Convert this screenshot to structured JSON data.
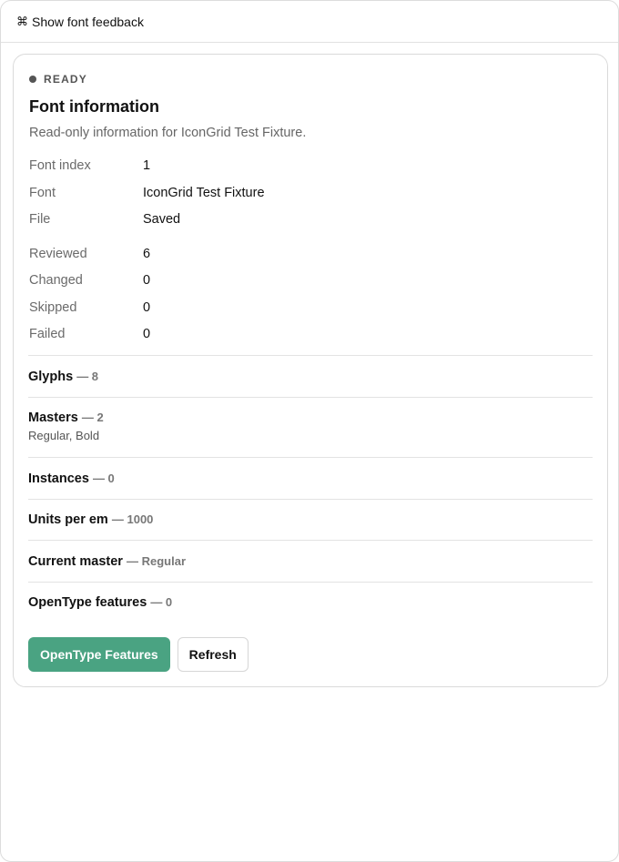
{
  "topbar": {
    "shortcut_icon": "⌘",
    "label": "Show font feedback"
  },
  "status": {
    "label": "READY",
    "dot_color": "#555555"
  },
  "header": {
    "title": "Font information",
    "subtitle": "Read-only information for IconGrid Test Fixture."
  },
  "info": [
    {
      "key": "Font index",
      "value": "1"
    },
    {
      "key": "Font",
      "value": "IconGrid Test Fixture"
    },
    {
      "key": "File",
      "value": "Saved"
    }
  ],
  "stats": [
    {
      "key": "Reviewed",
      "value": "6"
    },
    {
      "key": "Changed",
      "value": "0"
    },
    {
      "key": "Skipped",
      "value": "0"
    },
    {
      "key": "Failed",
      "value": "0"
    }
  ],
  "sections": [
    {
      "label": "Glyphs",
      "value": "— 8",
      "sub": ""
    },
    {
      "label": "Masters",
      "value": "— 2",
      "sub": "Regular, Bold"
    },
    {
      "label": "Instances",
      "value": "— 0",
      "sub": ""
    },
    {
      "label": "Units per em",
      "value": "— 1000",
      "sub": ""
    },
    {
      "label": "Current master",
      "value": "— Regular",
      "sub": ""
    },
    {
      "label": "OpenType features",
      "value": "— 0",
      "sub": ""
    }
  ],
  "actions": {
    "primary_label": "OpenType Features",
    "secondary_label": "Refresh"
  },
  "colors": {
    "accent": "#4aa382",
    "border": "#dadada",
    "muted_text": "#666666"
  }
}
